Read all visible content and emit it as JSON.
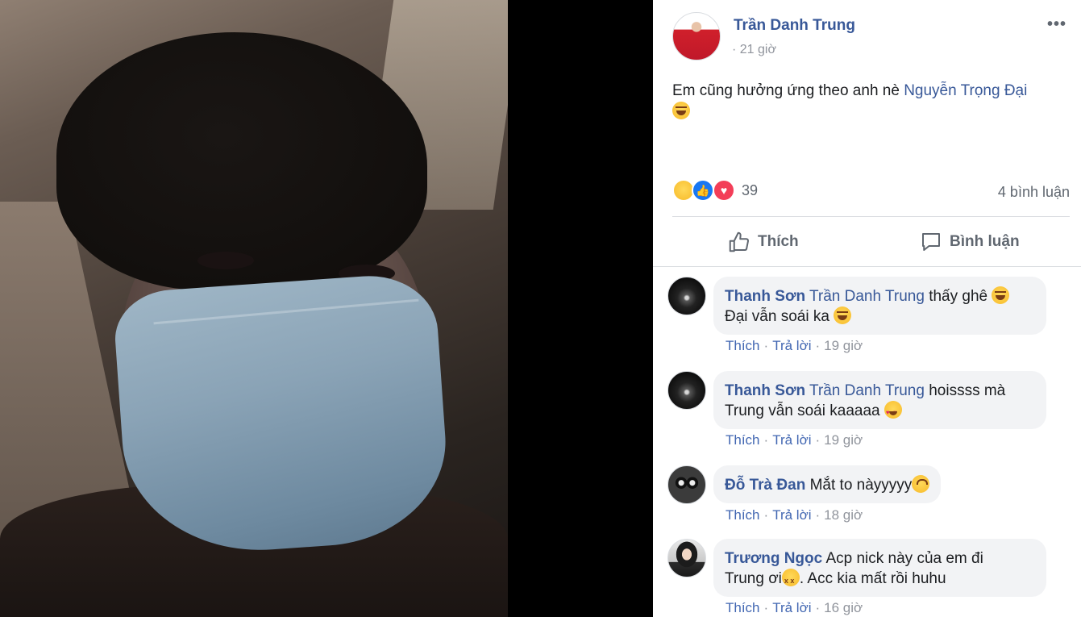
{
  "post": {
    "author": "Trần Danh Trung",
    "time": "· 21 giờ",
    "more": "•••",
    "text_before": "Em cũng hưởng ứng theo anh nè ",
    "mention": "Nguyễn Trọng Đại",
    "reaction_count": "39",
    "comment_count": "4 bình luận",
    "like_label": "Thích",
    "comment_label": "Bình luận"
  },
  "comments": [
    {
      "name": "Thanh Sơn",
      "mention": "Trần Danh Trung",
      "text1": " thấy ghê ",
      "line2": "Đại vẫn soái ka ",
      "like": "Thích",
      "reply": "Trả lời",
      "time": "19 giờ"
    },
    {
      "name": "Thanh Sơn",
      "mention": "Trần Danh Trung",
      "text1": " hoissss mà",
      "line2": "Trung vẫn soái kaaaaa ",
      "like": "Thích",
      "reply": "Trả lời",
      "time": "19 giờ"
    },
    {
      "name": "Đỗ Trà Đan",
      "text1": " Mắt to nàyyyyy",
      "like": "Thích",
      "reply": "Trả lời",
      "time": "18 giờ"
    },
    {
      "name": "Trương Ngọc",
      "text1": " Acp nick này của em đi",
      "line2a": "Trung ơi",
      "line2b": ". Acc kia mất rồi huhu",
      "like": "Thích",
      "reply": "Trả lời",
      "time": "16 giờ"
    }
  ],
  "icons": {
    "reactions": [
      "haha-icon",
      "like-icon",
      "love-icon"
    ],
    "like_action": "thumbs-up-icon",
    "comment_action": "speech-bubble-icon"
  },
  "colors": {
    "link": "#385898",
    "meta": "#90949c",
    "bubble": "#f2f3f5",
    "like_blue": "#1877f2",
    "love_red": "#f33e58"
  }
}
